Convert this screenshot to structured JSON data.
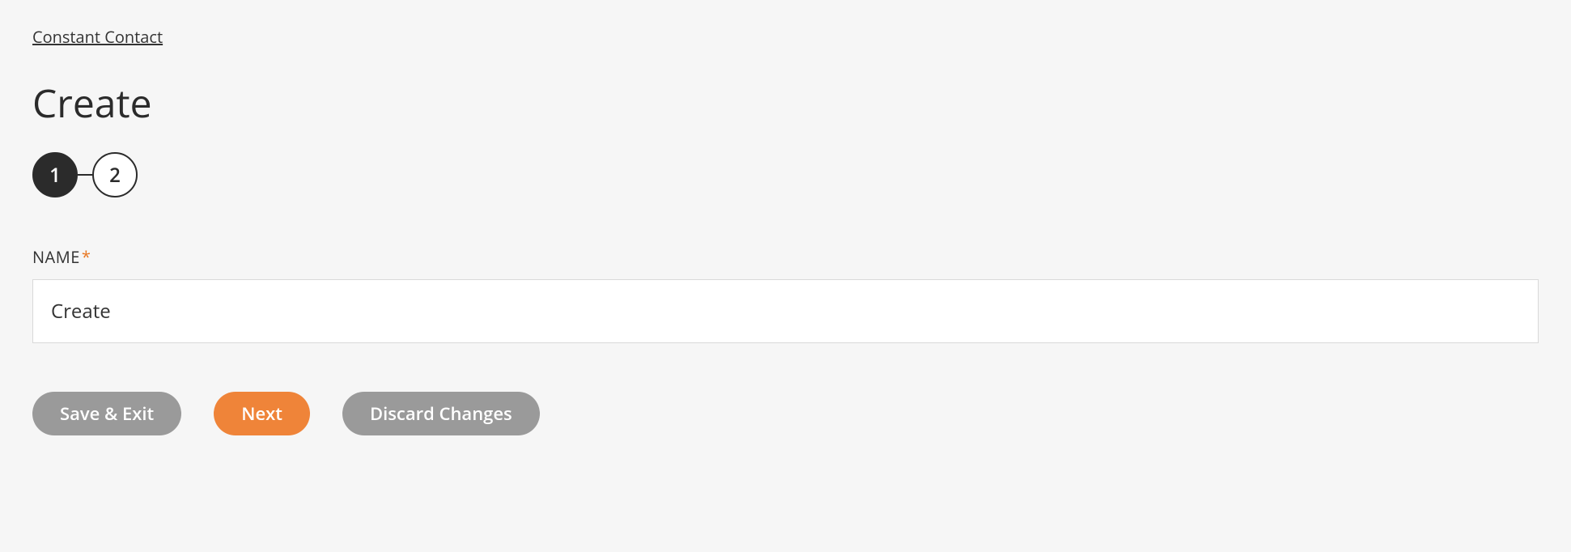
{
  "breadcrumb": {
    "label": "Constant Contact"
  },
  "page": {
    "title": "Create"
  },
  "stepper": {
    "steps": [
      {
        "num": "1",
        "active": true
      },
      {
        "num": "2",
        "active": false
      }
    ]
  },
  "form": {
    "name": {
      "label": "NAME",
      "required_marker": "*",
      "value": "Create"
    }
  },
  "buttons": {
    "save_exit": "Save & Exit",
    "next": "Next",
    "discard": "Discard Changes"
  }
}
